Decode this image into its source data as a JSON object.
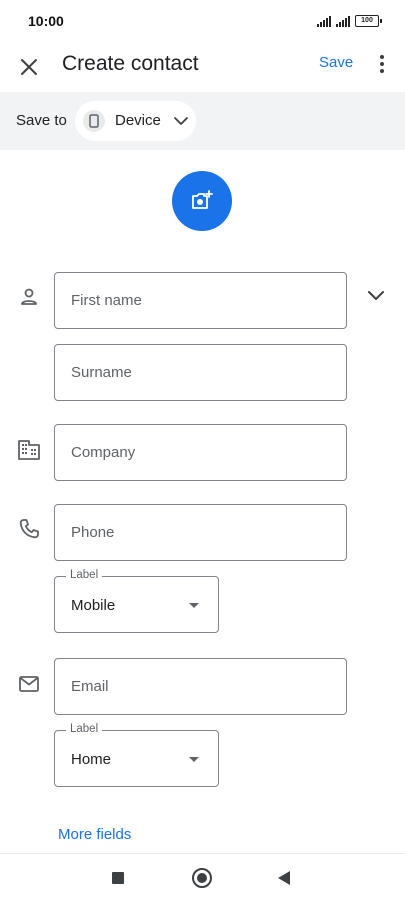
{
  "status_bar": {
    "time": "10:00",
    "battery": "100",
    "icons": [
      "signal-icon",
      "signal-icon",
      "battery-icon"
    ]
  },
  "app_bar": {
    "close_icon": "close-icon",
    "title": "Create contact",
    "save_label": "Save",
    "more_icon": "more-vert-icon"
  },
  "save_to": {
    "label": "Save to",
    "account_label": "Device",
    "account_icon": "phone-device-icon",
    "caret_icon": "chevron-down-icon",
    "background": "#f1f3f4"
  },
  "photo": {
    "icon": "add-photo-icon",
    "color": "#1a73e8"
  },
  "name": {
    "icon": "person-icon",
    "first_name_placeholder": "First name",
    "surname_placeholder": "Surname",
    "expand_icon": "chevron-down-icon"
  },
  "company": {
    "icon": "business-icon",
    "placeholder": "Company"
  },
  "phone": {
    "icon": "phone-icon",
    "placeholder": "Phone",
    "label_caption": "Label",
    "label_value": "Mobile"
  },
  "email": {
    "icon": "email-icon",
    "placeholder": "Email",
    "label_caption": "Label",
    "label_value": "Home"
  },
  "more_fields_label": "More fields",
  "nav_bar": {
    "icons": [
      "recents-square-icon",
      "home-circle-icon",
      "back-triangle-icon"
    ]
  },
  "colors": {
    "accent": "#1a73e8",
    "text_primary": "#202124",
    "text_secondary": "#5f6368",
    "outline": "#80868b"
  }
}
